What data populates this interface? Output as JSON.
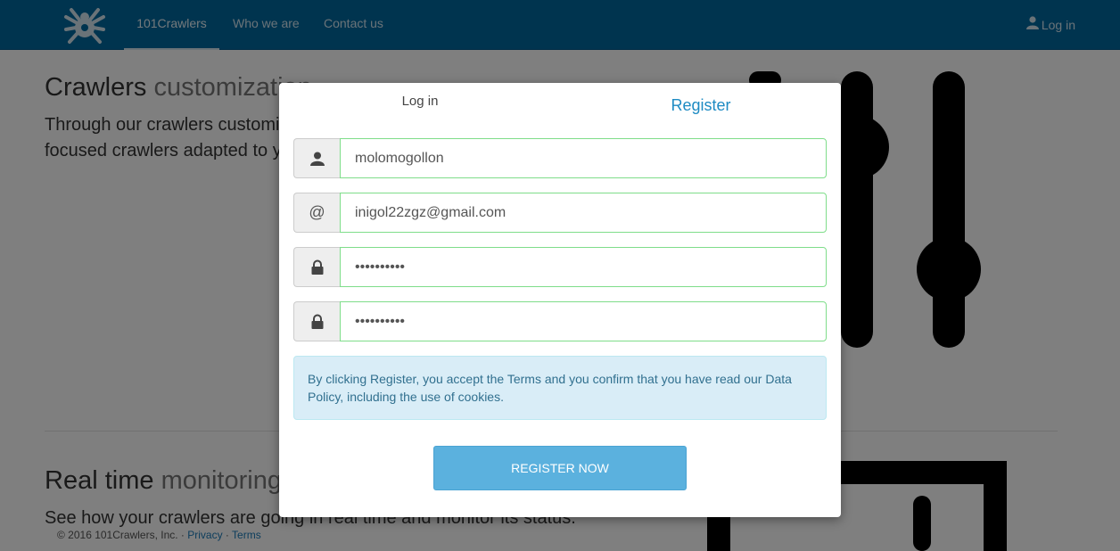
{
  "navbar": {
    "brand": "101Crawlers",
    "items": [
      {
        "label": "101Crawlers"
      },
      {
        "label": "Who we are"
      },
      {
        "label": "Contact us"
      }
    ],
    "login_label": "Log in"
  },
  "page": {
    "section1": {
      "title_main": "Crawlers",
      "title_muted": "customization",
      "text_line1": "Through our crawlers customization service you can have",
      "text_line2": "focused crawlers adapted to your needs."
    },
    "section2": {
      "title_main": "Real time",
      "title_muted": "monitoring",
      "text": "See how your crawlers are going in real time and monitor its status."
    },
    "footer": {
      "copyright": "© 2016 101Crawlers, Inc. · ",
      "privacy": "Privacy",
      "separator": " · ",
      "terms": "Terms"
    }
  },
  "modal": {
    "tabs": {
      "login": "Log in",
      "register": "Register"
    },
    "fields": {
      "username": {
        "value": "molomogollon",
        "icon": "user-icon"
      },
      "email": {
        "value": "inigol22zgz@gmail.com",
        "icon": "at-icon",
        "addon_text": "@"
      },
      "password": {
        "value": "••••••••••",
        "icon": "lock-icon"
      },
      "password_confirm": {
        "value": "••••••••••",
        "icon": "lock-icon"
      }
    },
    "notice": "By clicking Register, you accept the Terms and you confirm that you have read our Data Policy, including the use of cookies.",
    "register_button": "REGISTER NOW"
  },
  "colors": {
    "navbar": "#01689f",
    "accent": "#1e8bc3",
    "button": "#5bb1de",
    "valid_border": "#7fdd8a",
    "notice_bg": "#d9edf7"
  }
}
